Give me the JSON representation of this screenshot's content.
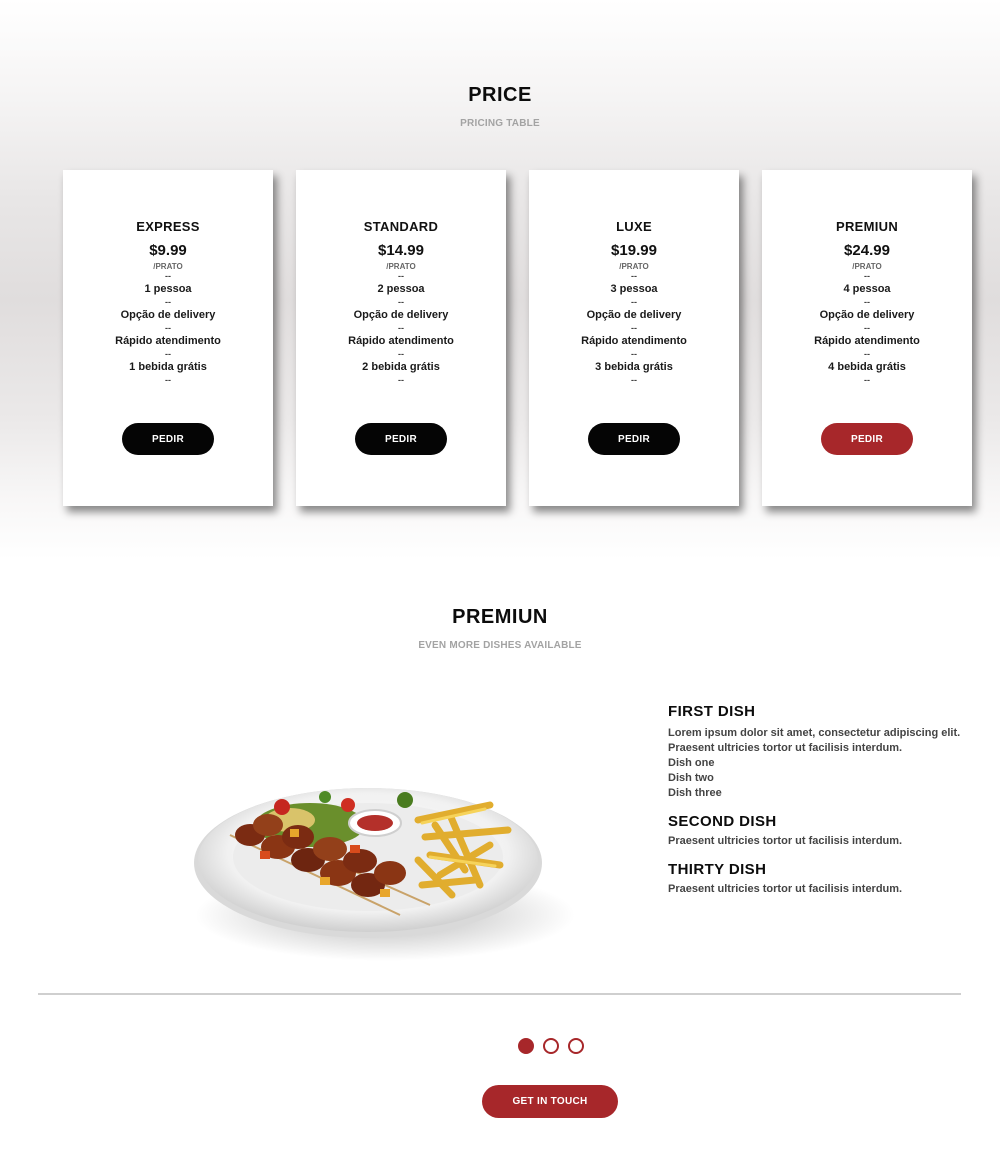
{
  "pricing": {
    "title": "PRICE",
    "subtitle": "PRICING TABLE",
    "separator": "--",
    "cards": [
      {
        "name": "EXPRESS",
        "price": "$9.99",
        "unit": "/PRATO",
        "features": [
          "1 pessoa",
          "Opção de delivery",
          "Rápido atendimento",
          "1 bebida grátis"
        ],
        "button": "PEDIR"
      },
      {
        "name": "STANDARD",
        "price": "$14.99",
        "unit": "/PRATO",
        "features": [
          "2 pessoa",
          "Opção de delivery",
          "Rápido atendimento",
          "2 bebida grátis"
        ],
        "button": "PEDIR"
      },
      {
        "name": "LUXE",
        "price": "$19.99",
        "unit": "/PRATO",
        "features": [
          "3 pessoa",
          "Opção de delivery",
          "Rápido atendimento",
          "3 bebida grátis"
        ],
        "button": "PEDIR"
      },
      {
        "name": "PREMIUN",
        "price": "$24.99",
        "unit": "/PRATO",
        "features": [
          "4 pessoa",
          "Opção de delivery",
          "Rápido atendimento",
          "4 bebida grátis"
        ],
        "button": "PEDIR"
      }
    ]
  },
  "premium": {
    "title": "PREMIUN",
    "subtitle": "EVEN MORE DISHES AVAILABLE",
    "dishes": [
      {
        "title": "FIRST DISH",
        "lines": [
          "Lorem ipsum dolor sit amet, consectetur adipiscing elit.",
          "Praesent ultricies tortor ut facilisis interdum.",
          "Dish one",
          "Dish two",
          "Dish three"
        ]
      },
      {
        "title": "SECOND DISH",
        "lines": [
          "Praesent ultricies tortor ut facilisis interdum."
        ]
      },
      {
        "title": "THIRTY DISH",
        "lines": [
          "Praesent ultricies tortor ut facilisis interdum."
        ]
      }
    ]
  },
  "carousel": {
    "slides": 3,
    "active": 0
  },
  "cta": {
    "label": "GET IN TOUCH"
  },
  "colors": {
    "accent": "#a7272a",
    "dark": "#050505",
    "muted": "#a3a3a3"
  }
}
